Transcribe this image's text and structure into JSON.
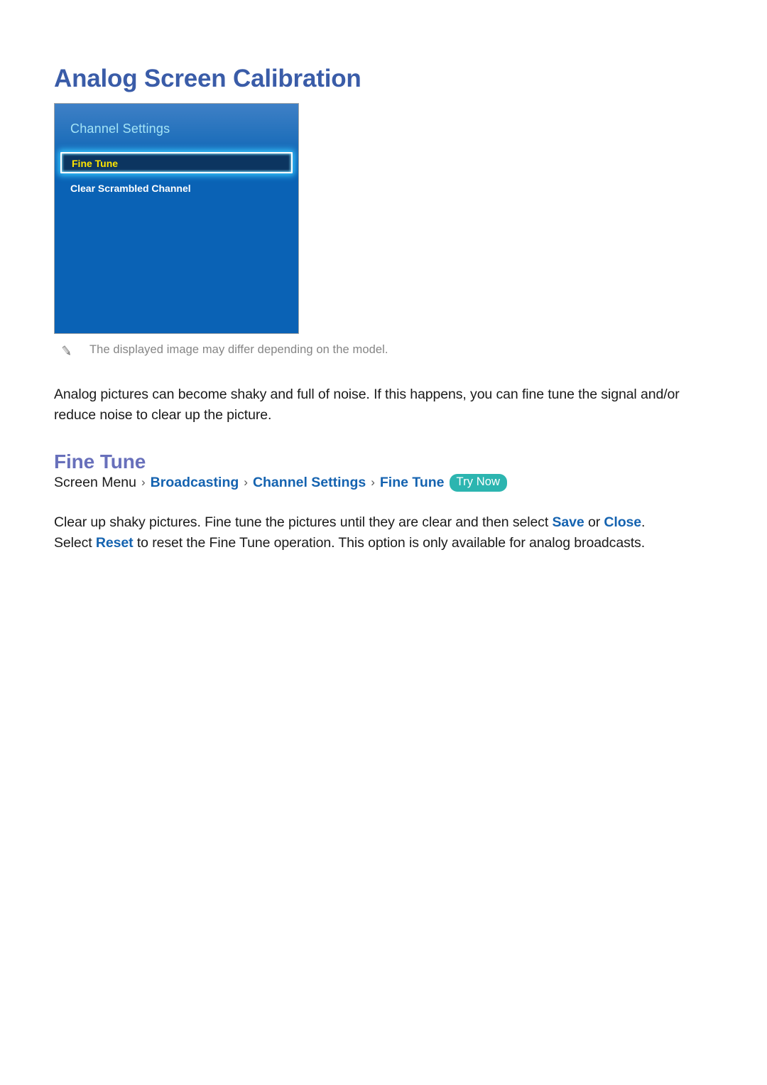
{
  "document": {
    "title": "Analog Screen Calibration"
  },
  "tv_panel": {
    "header": "Channel Settings",
    "menu_items": [
      {
        "label": "Fine Tune",
        "selected": true
      },
      {
        "label": "Clear Scrambled Channel",
        "selected": false
      }
    ]
  },
  "note": {
    "icon": "pencil-icon",
    "text": "The displayed image may differ depending on the model."
  },
  "intro_paragraph": "Analog pictures can become shaky and full of noise. If this happens, you can fine tune the signal and/or reduce noise to clear up the picture.",
  "section": {
    "heading": "Fine Tune",
    "breadcrumb": {
      "root": "Screen Menu",
      "separator": "›",
      "links": [
        "Broadcasting",
        "Channel Settings",
        "Fine Tune"
      ],
      "badge": "Try Now"
    },
    "description": {
      "part1": "Clear up shaky pictures. Fine tune the pictures until they are clear and then select ",
      "kw1": "Save",
      "part2": " or ",
      "kw2": "Close",
      "part3": ". Select ",
      "kw3": "Reset",
      "part4": " to reset the Fine Tune operation. This option is only available for analog broadcasts."
    }
  },
  "colors": {
    "title_blue": "#3a5ca8",
    "heading_purple": "#6870bb",
    "link_blue": "#1563b0",
    "badge_teal": "#2cb5b0",
    "panel_blue": "#0a62b5",
    "panel_header_cyan": "#a3e4f7",
    "selected_yellow": "#ffe400",
    "selected_navy": "#0c3560",
    "note_gray": "#858585"
  }
}
